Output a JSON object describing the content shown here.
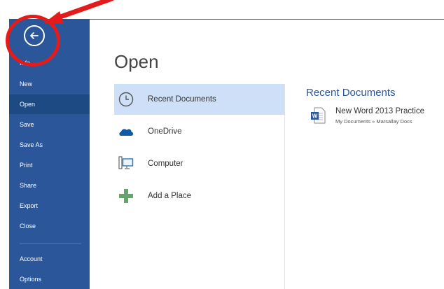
{
  "sidebar": {
    "back_icon": "back-arrow-circle-icon",
    "items": [
      {
        "label": "Info"
      },
      {
        "label": "New"
      },
      {
        "label": "Open",
        "active": true
      },
      {
        "label": "Save"
      },
      {
        "label": "Save As"
      },
      {
        "label": "Print"
      },
      {
        "label": "Share"
      },
      {
        "label": "Export"
      },
      {
        "label": "Close"
      },
      {
        "label": "Account"
      },
      {
        "label": "Options"
      }
    ]
  },
  "main": {
    "title": "Open",
    "places": [
      {
        "label": "Recent Documents",
        "icon": "clock-icon",
        "selected": true
      },
      {
        "label": "OneDrive",
        "icon": "cloud-icon"
      },
      {
        "label": "Computer",
        "icon": "computer-icon"
      },
      {
        "label": "Add a Place",
        "icon": "plus-icon"
      }
    ],
    "recent": {
      "heading": "Recent Documents",
      "documents": [
        {
          "name": "New Word 2013 Practice",
          "path": "My Documents » Marsallay Docs",
          "icon": "word-doc-icon"
        }
      ]
    }
  },
  "colors": {
    "sidebar": "#2b579a",
    "sidebar_active": "#1e4a84",
    "selected_place": "#cde0f7",
    "annotation": "#e41b1b"
  },
  "annotation": {
    "icon": "red-arrow-icon"
  }
}
